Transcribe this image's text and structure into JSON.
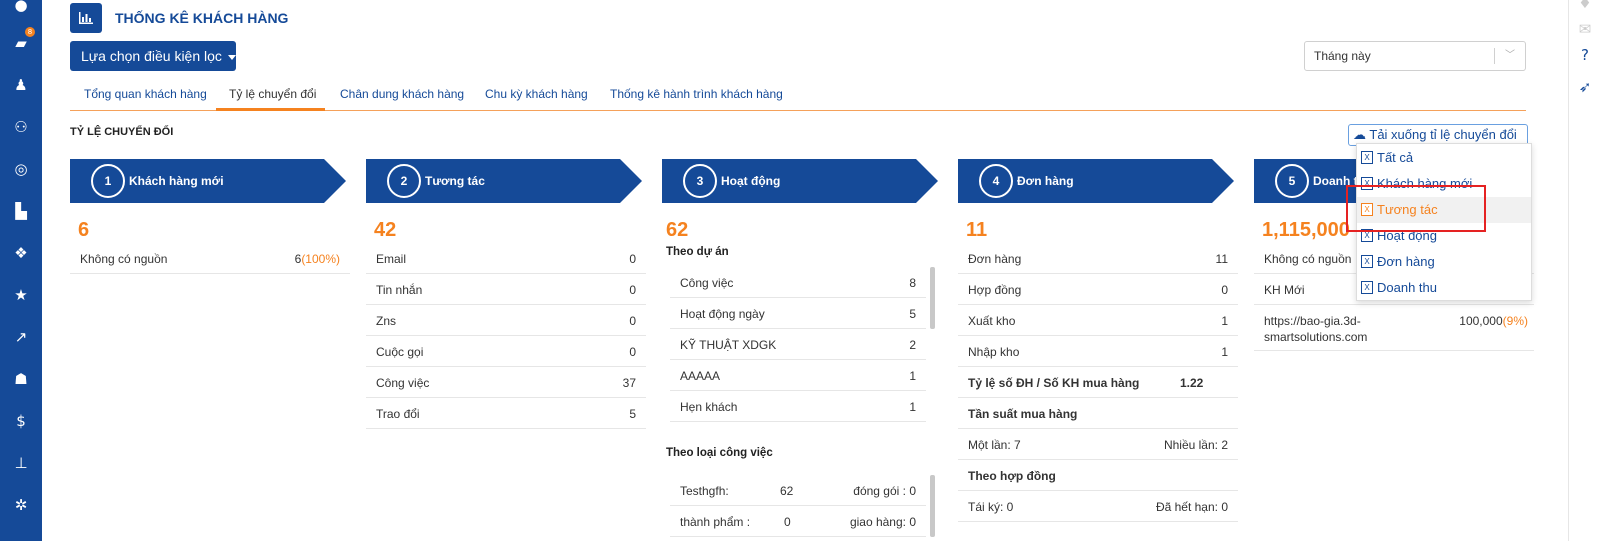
{
  "header": {
    "title": "THỐNG KÊ KHÁCH HÀNG",
    "filter_label": "Lựa chọn điều kiện lọc",
    "period_value": "Tháng này"
  },
  "tabs": [
    {
      "label": "Tổng quan khách hàng"
    },
    {
      "label": "Tỷ lệ chuyển đổi"
    },
    {
      "label": "Chân dung khách hàng"
    },
    {
      "label": "Chu kỳ khách hàng"
    },
    {
      "label": "Thống kê hành trình khách hàng"
    }
  ],
  "section_title": "TỶ LỆ CHUYỂN ĐỔI",
  "download_label": "Tải xuống tỉ lệ chuyển đổi",
  "sidebar": {
    "badge": "8"
  },
  "stages": [
    {
      "step": "1",
      "title": "Khách hàng mới",
      "total": "6",
      "rows": [
        {
          "label": "Không có nguồn",
          "value": "6",
          "pct": "(100%)"
        }
      ]
    },
    {
      "step": "2",
      "title": "Tương tác",
      "total": "42",
      "rows": [
        {
          "label": "Email",
          "value": "0"
        },
        {
          "label": "Tin nhắn",
          "value": "0"
        },
        {
          "label": "Zns",
          "value": "0"
        },
        {
          "label": "Cuộc gọi",
          "value": "0"
        },
        {
          "label": "Công việc",
          "value": "37"
        },
        {
          "label": "Trao đổi",
          "value": "5"
        }
      ]
    },
    {
      "step": "3",
      "title": "Hoạt động",
      "total": "62",
      "project_heading": "Theo dự án",
      "project_rows": [
        {
          "label": "Công việc",
          "value": "8"
        },
        {
          "label": "Hoạt động ngày",
          "value": "5"
        },
        {
          "label": "KỸ THUẬT XDGK",
          "value": "2"
        },
        {
          "label": "AAAAA",
          "value": "1"
        },
        {
          "label": "Hẹn khách",
          "value": "1"
        }
      ],
      "type_heading": "Theo loại công việc",
      "type_rows": [
        {
          "a": "Testhgfh:",
          "b": "62",
          "c": "đóng gói : 0"
        },
        {
          "a": "thành phẩm :",
          "b": "0",
          "c": "giao hàng: 0"
        }
      ]
    },
    {
      "step": "4",
      "title": "Đơn hàng",
      "total": "11",
      "rows": [
        {
          "label": "Đơn hàng",
          "value": "11"
        },
        {
          "label": "Hợp đồng",
          "value": "0"
        },
        {
          "label": "Xuất kho",
          "value": "1"
        },
        {
          "label": "Nhập kho",
          "value": "1"
        }
      ],
      "ratio_label": "Tỷ lệ số ĐH / Số KH mua hàng",
      "ratio_value": "1.22",
      "freq_heading": "Tần suất mua hàng",
      "freq_once": "Một lần: 7",
      "freq_many": "Nhiều lần: 2",
      "contract_heading": "Theo hợp đồng",
      "contract_renew": "Tái ký: 0",
      "contract_expired": "Đã hết hạn: 0"
    },
    {
      "step": "5",
      "title": "Doanh t",
      "total": "1,115,000",
      "rows": [
        {
          "label": "Không có nguồn",
          "value": ""
        },
        {
          "label": "KH Mới",
          "value": ""
        }
      ],
      "url_line1": "https://bao-gia.3d-",
      "url_line2": "smartsolutions.com",
      "url_value": "100,000",
      "url_pct": "(9%)"
    }
  ],
  "download_menu": [
    {
      "label": "Tất cả"
    },
    {
      "label": "Khách hàng mới"
    },
    {
      "label": "Tương tác"
    },
    {
      "label": "Hoạt động"
    },
    {
      "label": "Đơn hàng"
    },
    {
      "label": "Doanh thu"
    }
  ],
  "colors": {
    "primary": "#154a98",
    "accent": "#f5821f",
    "highlight_box": "#e52222"
  }
}
